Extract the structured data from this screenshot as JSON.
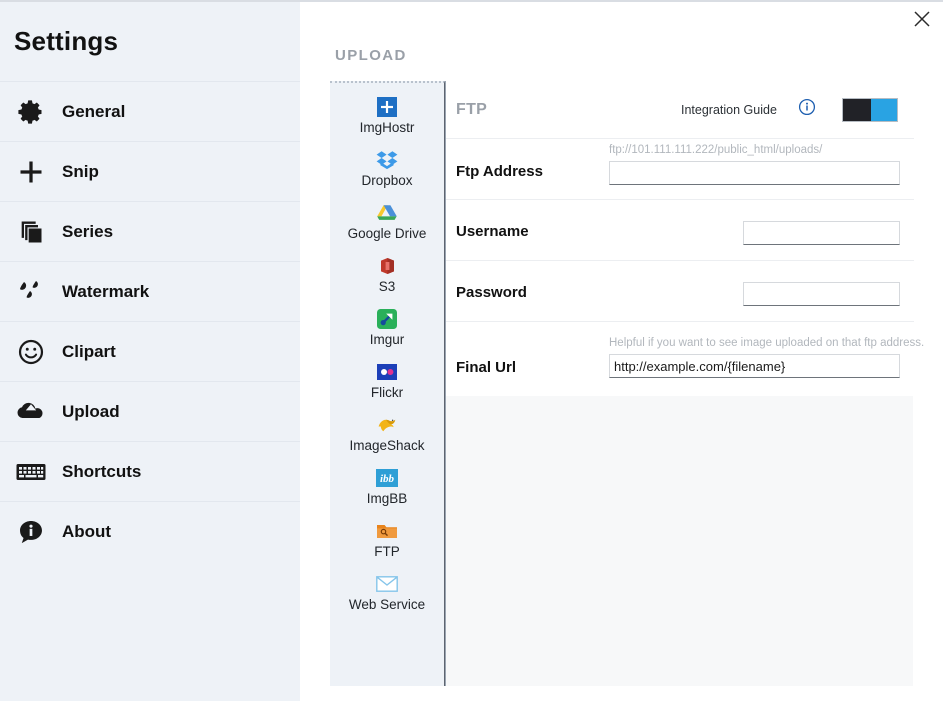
{
  "sidebar": {
    "title": "Settings",
    "items": [
      {
        "label": "General",
        "icon": "gear-icon"
      },
      {
        "label": "Snip",
        "icon": "plus-icon"
      },
      {
        "label": "Series",
        "icon": "copy-stack-icon"
      },
      {
        "label": "Watermark",
        "icon": "droplets-icon"
      },
      {
        "label": "Clipart",
        "icon": "smiley-icon"
      },
      {
        "label": "Upload",
        "icon": "cloud-upload-icon"
      },
      {
        "label": "Shortcuts",
        "icon": "keyboard-icon"
      },
      {
        "label": "About",
        "icon": "info-bubble-icon"
      }
    ]
  },
  "content": {
    "section_title": "UPLOAD",
    "close_icon": "close-icon"
  },
  "services": [
    {
      "label": "ImgHostr",
      "icon": "imghostr-icon"
    },
    {
      "label": "Dropbox",
      "icon": "dropbox-icon"
    },
    {
      "label": "Google Drive",
      "icon": "google-drive-icon"
    },
    {
      "label": "S3",
      "icon": "amazon-s3-icon"
    },
    {
      "label": "Imgur",
      "icon": "imgur-icon"
    },
    {
      "label": "Flickr",
      "icon": "flickr-icon"
    },
    {
      "label": "ImageShack",
      "icon": "imageshack-icon"
    },
    {
      "label": "ImgBB",
      "icon": "imgbb-icon"
    },
    {
      "label": "FTP",
      "icon": "ftp-folder-icon"
    },
    {
      "label": "Web Service",
      "icon": "envelope-icon"
    }
  ],
  "ftp_panel": {
    "header": {
      "name": "FTP",
      "guide_label": "Integration Guide",
      "info_icon": "info-circle-icon",
      "toggle_enabled": true,
      "toggle_on_color": "#29a3e3",
      "toggle_knob_color": "#212227"
    },
    "fields": {
      "ftp_address": {
        "label": "Ftp Address",
        "hint": "ftp://101.111.111.222/public_html/uploads/",
        "value": "",
        "placeholder": ""
      },
      "username": {
        "label": "Username",
        "value": "",
        "placeholder": ""
      },
      "password": {
        "label": "Password",
        "value": "",
        "placeholder": ""
      },
      "final_url": {
        "label": "Final Url",
        "hint": "Helpful if you want to see image uploaded on that ftp address.",
        "value": "http://example.com/{filename}",
        "placeholder": ""
      }
    }
  }
}
